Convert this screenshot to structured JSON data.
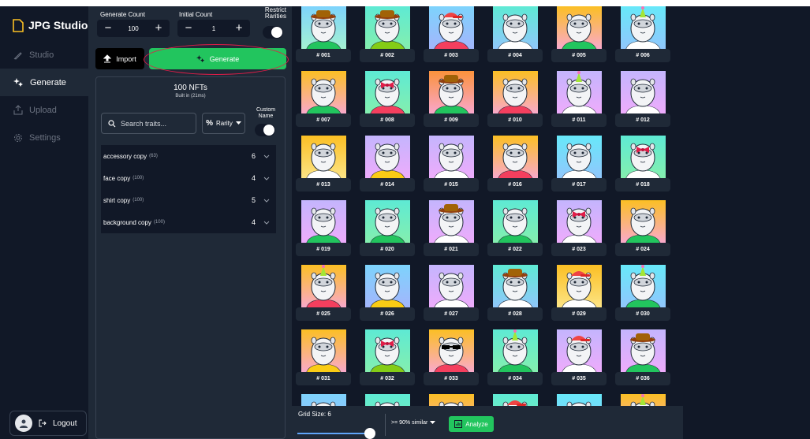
{
  "sidebar": {
    "brand": "JPG Studio",
    "items": [
      {
        "label": "Studio",
        "icon": "pen-icon",
        "active": false
      },
      {
        "label": "Generate",
        "icon": "sparkle-icon",
        "active": true
      },
      {
        "label": "Upload",
        "icon": "upload-icon",
        "active": false
      },
      {
        "label": "Settings",
        "icon": "gear-icon",
        "active": false
      }
    ],
    "logout_label": "Logout"
  },
  "config": {
    "generate_count_label": "Generate Count",
    "generate_count_value": "100",
    "initial_count_label": "Initial Count",
    "initial_count_value": "1",
    "restrict_rarities_label": "Restrict Rarities",
    "import_label": "Import",
    "generate_label": "Generate",
    "nft_count": "100 NFTs",
    "built_in": "Built in (21ms)",
    "search_placeholder": "Search traits...",
    "rarity_label": "Rarity",
    "custom_name_label": "Custom Name",
    "traits": [
      {
        "name": "accessory copy",
        "count": "(63)",
        "num": "6"
      },
      {
        "name": "face copy",
        "count": "(100)",
        "num": "4"
      },
      {
        "name": "shirt copy",
        "count": "(100)",
        "num": "5"
      },
      {
        "name": "background copy",
        "count": "(100)",
        "num": "4"
      }
    ]
  },
  "grid": {
    "grid_size_label": "Grid Size: 6",
    "similar_label": ">= 90% similar",
    "analyze_label": "Analyze",
    "items": [
      {
        "label": "# 001",
        "bg": [
          "#7dd3fc",
          "#a7f3d0"
        ],
        "hat": "cowboy",
        "shirt": "#22c55e"
      },
      {
        "label": "# 002",
        "bg": [
          "#5eead4",
          "#86efac"
        ],
        "hat": "cowboy",
        "shirt": "#84cc16"
      },
      {
        "label": "# 003",
        "bg": [
          "#7dd3fc",
          "#a5b4fc"
        ],
        "hat": "cap",
        "shirt": "#f43f5e"
      },
      {
        "label": "# 004",
        "bg": [
          "#5eead4",
          "#93c5fd"
        ],
        "hat": "",
        "shirt": "#ffffff"
      },
      {
        "label": "# 005",
        "bg": [
          "#fbbf24",
          "#f9a8d4"
        ],
        "hat": "",
        "shirt": "#22c55e"
      },
      {
        "label": "# 006",
        "bg": [
          "#67e8f9",
          "#93c5fd"
        ],
        "hat": "party",
        "shirt": "#ffffff"
      },
      {
        "label": "# 007",
        "bg": [
          "#fbbf24",
          "#f9a8d4"
        ],
        "hat": "",
        "shirt": "#22c55e"
      },
      {
        "label": "# 008",
        "bg": [
          "#5eead4",
          "#86efac"
        ],
        "hat": "bow",
        "shirt": "#f43f5e"
      },
      {
        "label": "# 009",
        "bg": [
          "#fb923c",
          "#f9a8d4"
        ],
        "hat": "cowboy",
        "shirt": "#22c55e"
      },
      {
        "label": "# 010",
        "bg": [
          "#fbbf24",
          "#f9a8d4"
        ],
        "hat": "",
        "shirt": "#f43f5e"
      },
      {
        "label": "# 011",
        "bg": [
          "#c4b5fd",
          "#f0abfc"
        ],
        "hat": "party",
        "shirt": "#ffffff"
      },
      {
        "label": "# 012",
        "bg": [
          "#c4b5fd",
          "#f0abfc"
        ],
        "hat": "",
        "shirt": "#ffffff"
      },
      {
        "label": "# 013",
        "bg": [
          "#fbbf24",
          "#fde68a"
        ],
        "hat": "",
        "shirt": "#ffffff"
      },
      {
        "label": "# 014",
        "bg": [
          "#c4b5fd",
          "#f0abfc"
        ],
        "hat": "",
        "shirt": "#facc15"
      },
      {
        "label": "# 015",
        "bg": [
          "#c4b5fd",
          "#f0abfc"
        ],
        "hat": "",
        "shirt": "#ffffff"
      },
      {
        "label": "# 016",
        "bg": [
          "#fbbf24",
          "#f9a8d4"
        ],
        "hat": "",
        "shirt": "#f43f5e"
      },
      {
        "label": "# 017",
        "bg": [
          "#67e8f9",
          "#93c5fd"
        ],
        "hat": "",
        "shirt": "#ffffff"
      },
      {
        "label": "# 018",
        "bg": [
          "#5eead4",
          "#86efac"
        ],
        "hat": "bow",
        "shirt": "#ffffff"
      },
      {
        "label": "# 019",
        "bg": [
          "#c4b5fd",
          "#f0abfc"
        ],
        "hat": "",
        "shirt": "#22c55e"
      },
      {
        "label": "# 020",
        "bg": [
          "#5eead4",
          "#86efac"
        ],
        "hat": "",
        "shirt": "#22c55e"
      },
      {
        "label": "# 021",
        "bg": [
          "#c4b5fd",
          "#f0abfc"
        ],
        "hat": "cowboy",
        "shirt": "#ffffff"
      },
      {
        "label": "# 022",
        "bg": [
          "#5eead4",
          "#86efac"
        ],
        "hat": "",
        "shirt": "#22c55e"
      },
      {
        "label": "# 023",
        "bg": [
          "#c4b5fd",
          "#f0abfc"
        ],
        "hat": "bow",
        "shirt": "#ffffff"
      },
      {
        "label": "# 024",
        "bg": [
          "#fbbf24",
          "#f9a8d4"
        ],
        "hat": "",
        "shirt": "#22c55e"
      },
      {
        "label": "# 025",
        "bg": [
          "#fbbf24",
          "#f9a8d4"
        ],
        "hat": "party",
        "shirt": "#f43f5e"
      },
      {
        "label": "# 026",
        "bg": [
          "#7dd3fc",
          "#a5b4fc"
        ],
        "hat": "",
        "shirt": "#facc15"
      },
      {
        "label": "# 027",
        "bg": [
          "#c4b5fd",
          "#f0abfc"
        ],
        "hat": "",
        "shirt": "#ffffff"
      },
      {
        "label": "# 028",
        "bg": [
          "#5eead4",
          "#93c5fd"
        ],
        "hat": "cowboy",
        "shirt": "#ffffff"
      },
      {
        "label": "# 029",
        "bg": [
          "#fbbf24",
          "#fde68a"
        ],
        "hat": "cap",
        "shirt": "#ffffff"
      },
      {
        "label": "# 030",
        "bg": [
          "#67e8f9",
          "#93c5fd"
        ],
        "hat": "party",
        "shirt": "#22c55e"
      },
      {
        "label": "# 031",
        "bg": [
          "#fbbf24",
          "#f9a8d4"
        ],
        "hat": "",
        "shirt": "#facc15"
      },
      {
        "label": "# 032",
        "bg": [
          "#5eead4",
          "#86efac"
        ],
        "hat": "bow",
        "shirt": "#84cc16"
      },
      {
        "label": "# 033",
        "bg": [
          "#fbbf24",
          "#f9a8d4"
        ],
        "hat": "glasses",
        "shirt": "#f43f5e"
      },
      {
        "label": "# 034",
        "bg": [
          "#5eead4",
          "#86efac"
        ],
        "hat": "party",
        "shirt": "#22c55e"
      },
      {
        "label": "# 035",
        "bg": [
          "#c4b5fd",
          "#f0abfc"
        ],
        "hat": "cap",
        "shirt": "#ffffff"
      },
      {
        "label": "# 036",
        "bg": [
          "#c4b5fd",
          "#f0abfc"
        ],
        "hat": "cowboy",
        "shirt": "#22c55e"
      },
      {
        "label": "",
        "bg": [
          "#7dd3fc",
          "#a5b4fc"
        ],
        "hat": "",
        "shirt": "#ffffff"
      },
      {
        "label": "",
        "bg": [
          "#5eead4",
          "#86efac"
        ],
        "hat": "",
        "shirt": "#ffffff"
      },
      {
        "label": "",
        "bg": [
          "#fbbf24",
          "#f9a8d4"
        ],
        "hat": "glasses",
        "shirt": "#ffffff"
      },
      {
        "label": "",
        "bg": [
          "#5eead4",
          "#86efac"
        ],
        "hat": "cap",
        "shirt": "#ffffff"
      },
      {
        "label": "",
        "bg": [
          "#67e8f9",
          "#93c5fd"
        ],
        "hat": "",
        "shirt": "#ffffff"
      },
      {
        "label": "",
        "bg": [
          "#fbbf24",
          "#f9a8d4"
        ],
        "hat": "party",
        "shirt": "#ffffff"
      }
    ]
  },
  "colors": {
    "accent": "#22c55e",
    "sidebar_bg": "#111827",
    "panel_bg": "#1f2937"
  }
}
